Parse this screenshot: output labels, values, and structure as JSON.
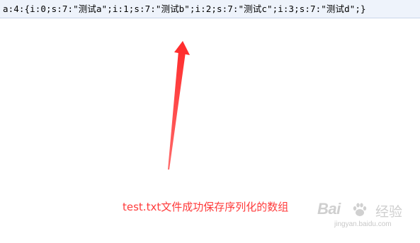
{
  "editor": {
    "line_text": "a:4:{i:0;s:7:\"测试a\";i:1;s:7:\"测试b\";i:2;s:7:\"测试c\";i:3;s:7:\"测试d\";}"
  },
  "annotation": {
    "caption": "test.txt文件成功保存序列化的数组",
    "arrow_color": "#ff3b3b"
  },
  "watermark": {
    "logo_text": "Bai",
    "logo_suffix": "经验",
    "url": "jingyan.baidu.com"
  },
  "colors": {
    "line_highlight": "#eef3fb",
    "caption": "#ff3a3a",
    "watermark": "#cfcfcf"
  },
  "icons": [
    "red-arrow-icon",
    "baidu-paw-icon"
  ]
}
